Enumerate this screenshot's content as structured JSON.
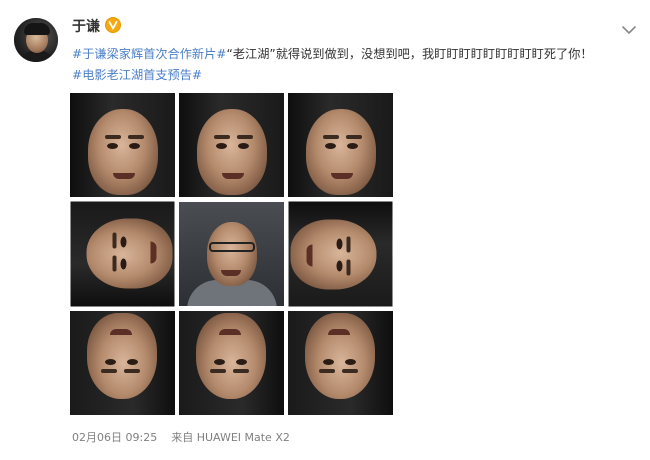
{
  "post": {
    "username": "于谦",
    "verified_icon": "v-badge-icon",
    "menu_icon": "chevron-down-icon",
    "line1": {
      "hashtag": "#于谦梁家辉首次合作新片#",
      "text": "“老江湖”就得说到做到，没想到吧，我盯盯盯盯盯盯盯盯盯死了你！"
    },
    "line2": {
      "hashtag": "#电影老江湖首支预告#"
    },
    "timestamp": "02月06日 09:25",
    "source": "来自 HUAWEI Mate X2"
  },
  "colors": {
    "hashtag": "#4b7fc9",
    "text": "#333333",
    "meta": "#808080",
    "badge": "#f4a913"
  }
}
